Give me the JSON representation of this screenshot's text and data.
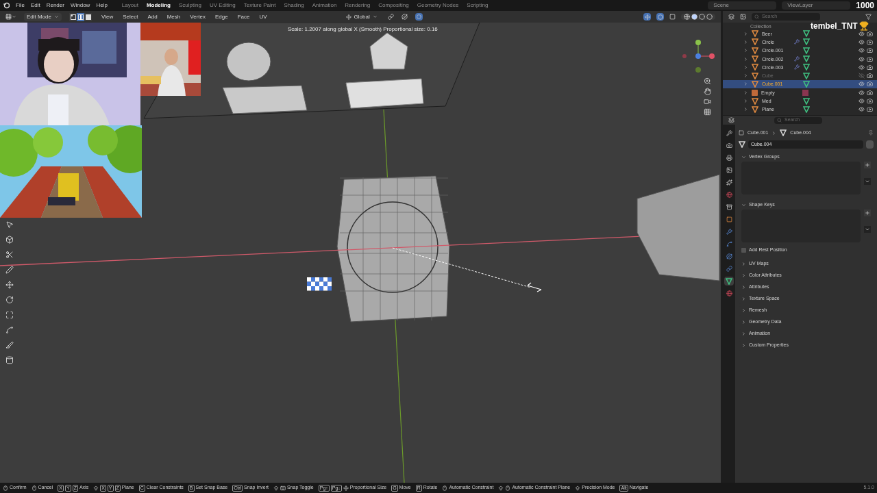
{
  "menu": [
    "File",
    "Edit",
    "Render",
    "Window",
    "Help"
  ],
  "workspaces": [
    {
      "label": "Layout",
      "selected": false
    },
    {
      "label": "Modeling",
      "selected": true
    },
    {
      "label": "Sculpting",
      "selected": false
    },
    {
      "label": "UV Editing",
      "selected": false
    },
    {
      "label": "Texture Paint",
      "selected": false
    },
    {
      "label": "Shading",
      "selected": false
    },
    {
      "label": "Animation",
      "selected": false
    },
    {
      "label": "Rendering",
      "selected": false
    },
    {
      "label": "Compositing",
      "selected": false
    },
    {
      "label": "Geometry Nodes",
      "selected": false
    },
    {
      "label": "Scripting",
      "selected": false
    }
  ],
  "scene": "Scene",
  "view_layer": "ViewLayer",
  "counter": "1000",
  "viewport_header": {
    "mode": "Edit Mode",
    "select_modes": [
      {
        "kind": "vertex",
        "selected": false
      },
      {
        "kind": "edge",
        "selected": true
      },
      {
        "kind": "face",
        "selected": false
      }
    ],
    "menus": [
      "View",
      "Select",
      "Add",
      "Mesh",
      "Vertex",
      "Edge",
      "Face",
      "UV"
    ],
    "orientation": "Global"
  },
  "operator_info": "Scale: 1.2007 along global X (Smooth) Proportional size: 0.16",
  "streamer_name": "tembel_TNT",
  "outliner": {
    "search_placeholder": "Search",
    "collection": "Collection",
    "items": [
      {
        "name": "Beer",
        "kind": "mesh",
        "modifier": false,
        "visible": true,
        "selected": false
      },
      {
        "name": "Circle",
        "kind": "mesh",
        "modifier": true,
        "visible": true,
        "selected": false
      },
      {
        "name": "Circle.001",
        "kind": "mesh",
        "modifier": false,
        "visible": true,
        "selected": false
      },
      {
        "name": "Circle.002",
        "kind": "mesh",
        "modifier": true,
        "visible": true,
        "selected": false
      },
      {
        "name": "Circle.003",
        "kind": "mesh",
        "modifier": true,
        "visible": true,
        "selected": false
      },
      {
        "name": "Cube",
        "kind": "mesh",
        "modifier": false,
        "visible": false,
        "selected": false
      },
      {
        "name": "Cube.001",
        "kind": "mesh",
        "modifier": false,
        "visible": true,
        "selected": true
      },
      {
        "name": "Empty",
        "kind": "empty",
        "modifier": false,
        "visible": true,
        "selected": false
      },
      {
        "name": "Med",
        "kind": "mesh",
        "modifier": false,
        "visible": true,
        "selected": false
      },
      {
        "name": "Plane",
        "kind": "mesh",
        "modifier": false,
        "visible": true,
        "selected": false
      }
    ]
  },
  "properties": {
    "search_placeholder": "Search",
    "tabs": [
      {
        "kind": "tool",
        "selected": false
      },
      {
        "kind": "render",
        "selected": false
      },
      {
        "kind": "output",
        "selected": false
      },
      {
        "kind": "view_layer",
        "selected": false
      },
      {
        "kind": "scene",
        "selected": false
      },
      {
        "kind": "world",
        "selected": false
      },
      {
        "kind": "collection",
        "selected": false
      },
      {
        "kind": "object",
        "selected": false
      },
      {
        "kind": "modifier",
        "selected": false
      },
      {
        "kind": "particles",
        "selected": false
      },
      {
        "kind": "physics",
        "selected": false
      },
      {
        "kind": "constraints",
        "selected": false
      },
      {
        "kind": "data",
        "selected": true
      },
      {
        "kind": "material",
        "selected": false
      }
    ],
    "breadcrumb": [
      "Cube.001",
      "Cube.004"
    ],
    "data_name": "Cube.004",
    "panels": [
      {
        "title": "Vertex Groups",
        "expanded": true,
        "kind": "list"
      },
      {
        "title": "Shape Keys",
        "expanded": true,
        "kind": "list",
        "option": {
          "label": "Add Rest Position",
          "checked": false
        }
      },
      {
        "title": "UV Maps",
        "expanded": false
      },
      {
        "title": "Color Attributes",
        "expanded": false
      },
      {
        "title": "Attributes",
        "expanded": false
      },
      {
        "title": "Texture Space",
        "expanded": false
      },
      {
        "title": "Remesh",
        "expanded": false
      },
      {
        "title": "Geometry Data",
        "expanded": false
      },
      {
        "title": "Animation",
        "expanded": false
      },
      {
        "title": "Custom Properties",
        "expanded": false
      }
    ]
  },
  "status_bar": {
    "items": [
      {
        "kind": "mouse",
        "shift": false,
        "label": "Confirm"
      },
      {
        "kind": "mouse",
        "shift": false,
        "label": "Cancel"
      },
      {
        "kind": "keys",
        "shift": false,
        "keys": [
          "X",
          "Y",
          "Z"
        ],
        "label": "Axis"
      },
      {
        "kind": "keys",
        "shift": true,
        "keys": [
          "X",
          "Y",
          "Z"
        ],
        "label": "Plane"
      },
      {
        "kind": "keys",
        "shift": false,
        "keys": [
          "C"
        ],
        "label": "Clear Constraints"
      },
      {
        "kind": "keys",
        "shift": false,
        "keys": [
          "B"
        ],
        "label": "Set Snap Base"
      },
      {
        "kind": "keys",
        "shift": false,
        "keys": [
          "Ctrl"
        ],
        "label": "Snap Invert"
      },
      {
        "kind": "keyboard",
        "shift": true,
        "label": "Snap Toggle"
      },
      {
        "kind": "page_keys",
        "shift": false,
        "keys": [
          "Pg↑",
          "Pg↓"
        ],
        "label": "Proportional Size"
      },
      {
        "kind": "keys",
        "shift": false,
        "keys": [
          "G"
        ],
        "label": "Move"
      },
      {
        "kind": "keys",
        "shift": false,
        "keys": [
          "R"
        ],
        "label": "Rotate"
      },
      {
        "kind": "mouse",
        "shift": false,
        "label": "Automatic Constraint"
      },
      {
        "kind": "mouse",
        "shift": true,
        "label": "Automatic Constraint Plane"
      },
      {
        "kind": "plain",
        "shift": true,
        "label": "Precision Mode"
      },
      {
        "kind": "keys",
        "shift": false,
        "keys": [
          "Alt"
        ],
        "label": "Navigate"
      }
    ],
    "version": "5.1.0"
  }
}
